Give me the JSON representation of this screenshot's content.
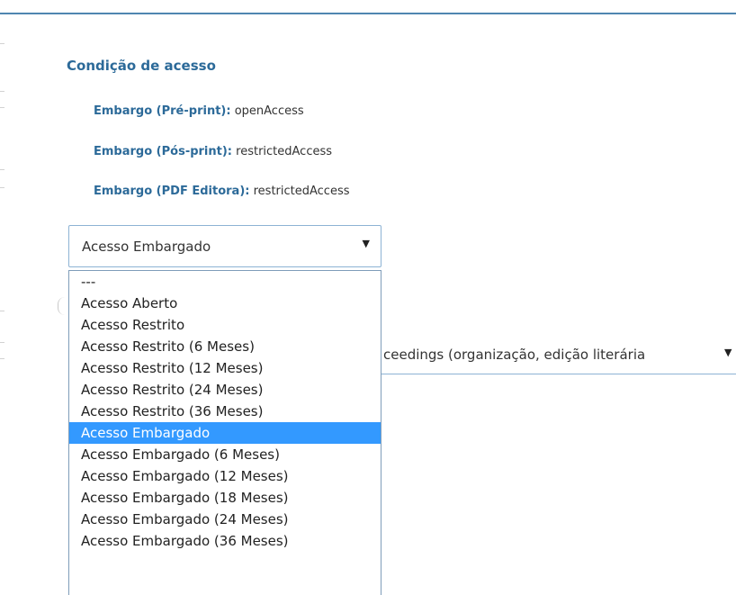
{
  "access_condition": {
    "title": "Condição de acesso",
    "embargo_lines": [
      {
        "label": "Embargo (Pré-print)",
        "value": "openAccess"
      },
      {
        "label": "Embargo (Pós-print)",
        "value": "restrictedAccess"
      },
      {
        "label": "Embargo (PDF Editora)",
        "value": "restrictedAccess"
      }
    ]
  },
  "access_select": {
    "selected_value": "Acesso Embargado",
    "arrow_icon": "dropdown-arrow-icon",
    "options": [
      "---",
      "Acesso Aberto",
      "Acesso Restrito",
      "Acesso Restrito (6 Meses)",
      "Acesso Restrito (12 Meses)",
      "Acesso Restrito (24 Meses)",
      "Acesso Restrito (36 Meses)",
      "Acesso Embargado",
      "Acesso Embargado (6 Meses)",
      "Acesso Embargado (12 Meses)",
      "Acesso Embargado (18 Meses)",
      "Acesso Embargado (24 Meses)",
      "Acesso Embargado (36 Meses)"
    ],
    "highlighted_index": 7
  },
  "type_select": {
    "visible_value": "ceedings (organização, edição literária"
  },
  "colors": {
    "accent": "#2c6a99",
    "rule": "#4f86b0",
    "highlight": "#3399ff"
  }
}
